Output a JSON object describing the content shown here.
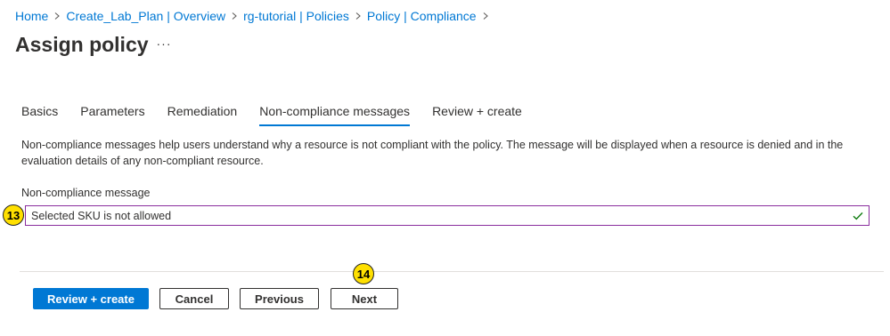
{
  "breadcrumb": {
    "items": [
      "Home",
      "Create_Lab_Plan | Overview",
      "rg-tutorial | Policies",
      "Policy | Compliance"
    ]
  },
  "page": {
    "title": "Assign policy",
    "more_label": "···"
  },
  "tabs": [
    {
      "label": "Basics",
      "active": false
    },
    {
      "label": "Parameters",
      "active": false
    },
    {
      "label": "Remediation",
      "active": false
    },
    {
      "label": "Non-compliance messages",
      "active": true
    },
    {
      "label": "Review + create",
      "active": false
    }
  ],
  "description": "Non-compliance messages help users understand why a resource is not compliant with the policy. The message will be displayed when a resource is denied and in the evaluation details of any non-compliant resource.",
  "form": {
    "message_label": "Non-compliance message",
    "message_value": "Selected SKU is not allowed"
  },
  "annotations": {
    "step_13": "13",
    "step_14": "14"
  },
  "footer": {
    "review_create": "Review + create",
    "cancel": "Cancel",
    "previous": "Previous",
    "next": "Next"
  },
  "colors": {
    "accent": "#0078d4",
    "input_border": "#8a2d9e",
    "valid_check": "#107c10",
    "badge": "#ffe000"
  },
  "icons": [
    "chevron-right-icon",
    "checkmark-icon"
  ]
}
